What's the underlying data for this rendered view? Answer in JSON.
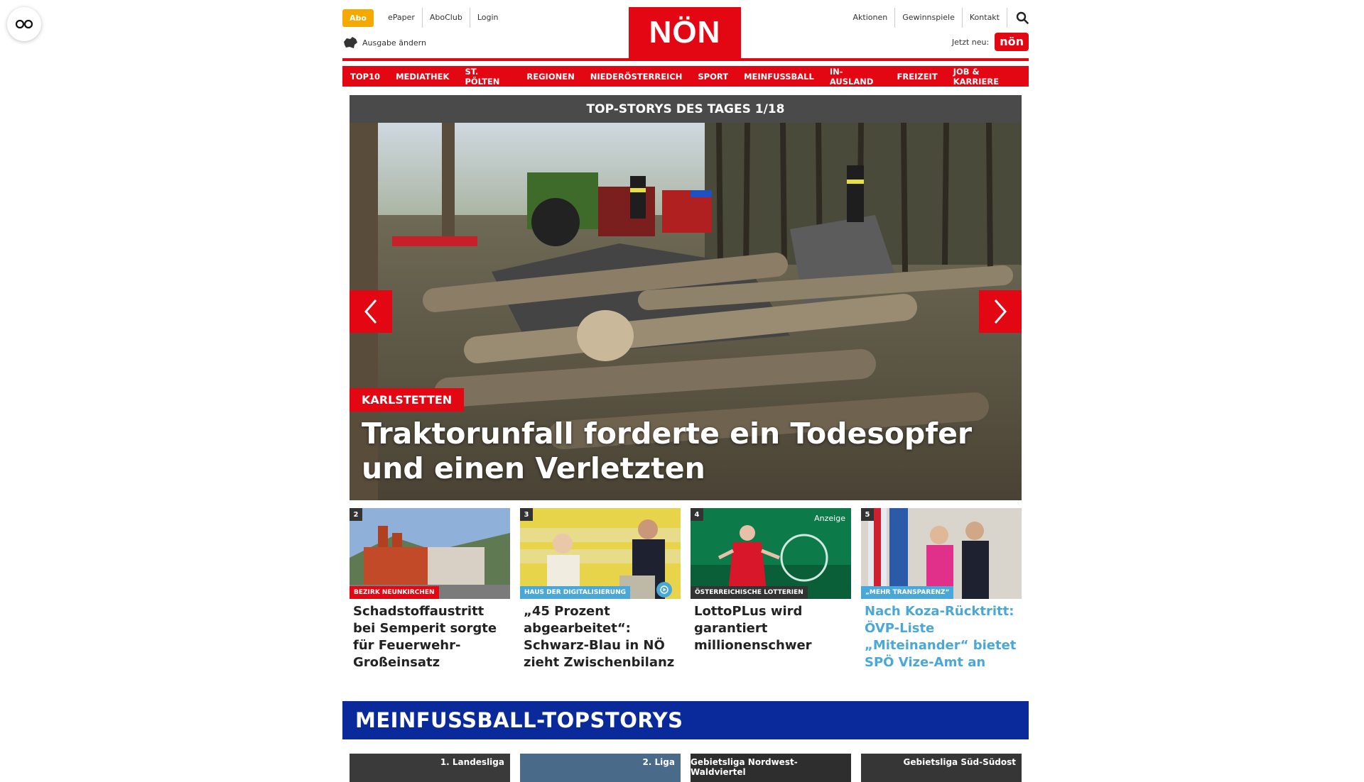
{
  "header": {
    "abo_label": "Abo",
    "util_links": [
      "ePaper",
      "AboClub",
      "Login"
    ],
    "ausgabe_label": "Ausgabe ändern",
    "logo_text": "NÖN",
    "right_links": [
      "Aktionen",
      "Gewinnspiele",
      "Kontakt"
    ],
    "jetzt_label": "Jetzt neu:",
    "mini_badge": "nön"
  },
  "nav": {
    "items": [
      "TOP10",
      "MEDIATHEK",
      "ST. PÖLTEN",
      "REGIONEN",
      "NIEDERÖSTERREICH",
      "SPORT",
      "MEINFUSSBALL",
      "IN-AUSLAND",
      "FREIZEIT",
      "JOB & KARRIERE"
    ]
  },
  "hero": {
    "heading": "TOP-STORYS DES TAGES 1/18",
    "tag": "KARLSTETTEN",
    "title": "Traktorunfall forderte ein Todesopfer und einen Verletzten"
  },
  "cards": [
    {
      "num": "2",
      "tag": "BEZIRK NEUNKIRCHEN",
      "title": "Schadstoffaustritt bei Semperit sorgte für Feuerwehr-Großeinsatz",
      "ad": ""
    },
    {
      "num": "3",
      "tag": "HAUS DER DIGITALISIERUNG",
      "title": "„45 Prozent abgearbeitet“: Schwarz-Blau in NÖ zieht Zwischenbilanz",
      "ad": ""
    },
    {
      "num": "4",
      "tag": "ÖSTERREICHISCHE LOTTERIEN",
      "title": "LottoPLus wird garantiert millionenschwer",
      "ad": "Anzeige"
    },
    {
      "num": "5",
      "tag": "„MEHR TRANSPARENZ“",
      "title": "Nach Koza-Rücktritt: ÖVP-Liste „Miteinander“ bietet SPÖ Vize-Amt an",
      "ad": ""
    }
  ],
  "meinfussball": {
    "heading": "MEINFUSSBALL-TOPSTORYS",
    "cards": [
      "1. Landesliga",
      "2. Liga",
      "Gebietsliga Nordwest-Waldviertel",
      "Gebietsliga Süd-Südost"
    ]
  },
  "colors": {
    "brand_red": "#e30613",
    "abo_yellow": "#f5a800",
    "meinfussball_blue": "#0a2a9c",
    "link_blue": "#4aa8d8"
  }
}
